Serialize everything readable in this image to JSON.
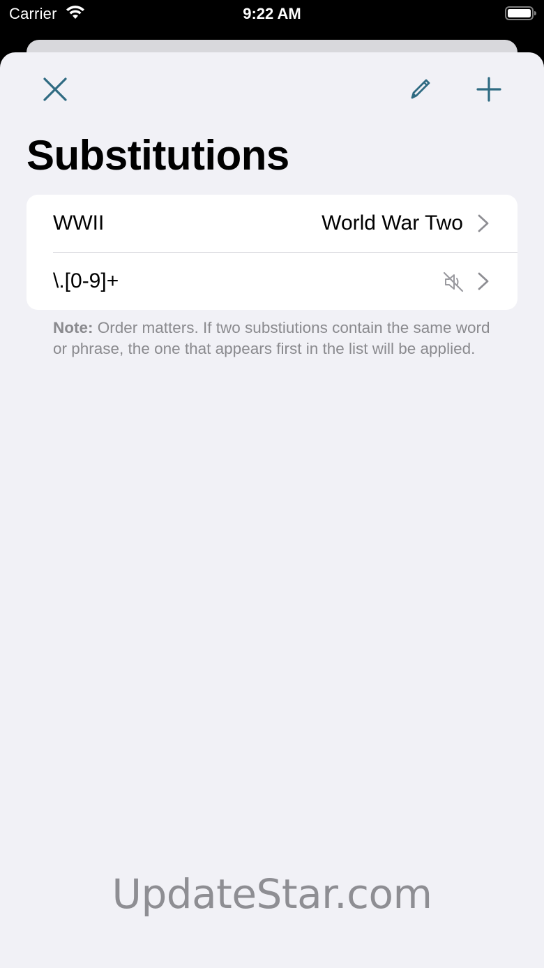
{
  "status_bar": {
    "carrier": "Carrier",
    "time": "9:22 AM"
  },
  "colors": {
    "accent": "#2f6b82",
    "sheet_background": "#f1f1f6",
    "secondary_text": "#8a8a8e"
  },
  "toolbar": {
    "close_icon": "close-icon",
    "edit_icon": "pencil-icon",
    "add_icon": "plus-icon"
  },
  "title": "Substitutions",
  "substitutions": [
    {
      "pattern": "WWII",
      "replacement": "World War Two",
      "muted": false
    },
    {
      "pattern": "\\.[0-9]+",
      "replacement": "",
      "muted": true
    }
  ],
  "note": {
    "label": "Note:",
    "text": " Order matters. If two substiutions contain the same word or phrase, the one that appears first in the list will be applied."
  },
  "watermark": "UpdateStar.com"
}
